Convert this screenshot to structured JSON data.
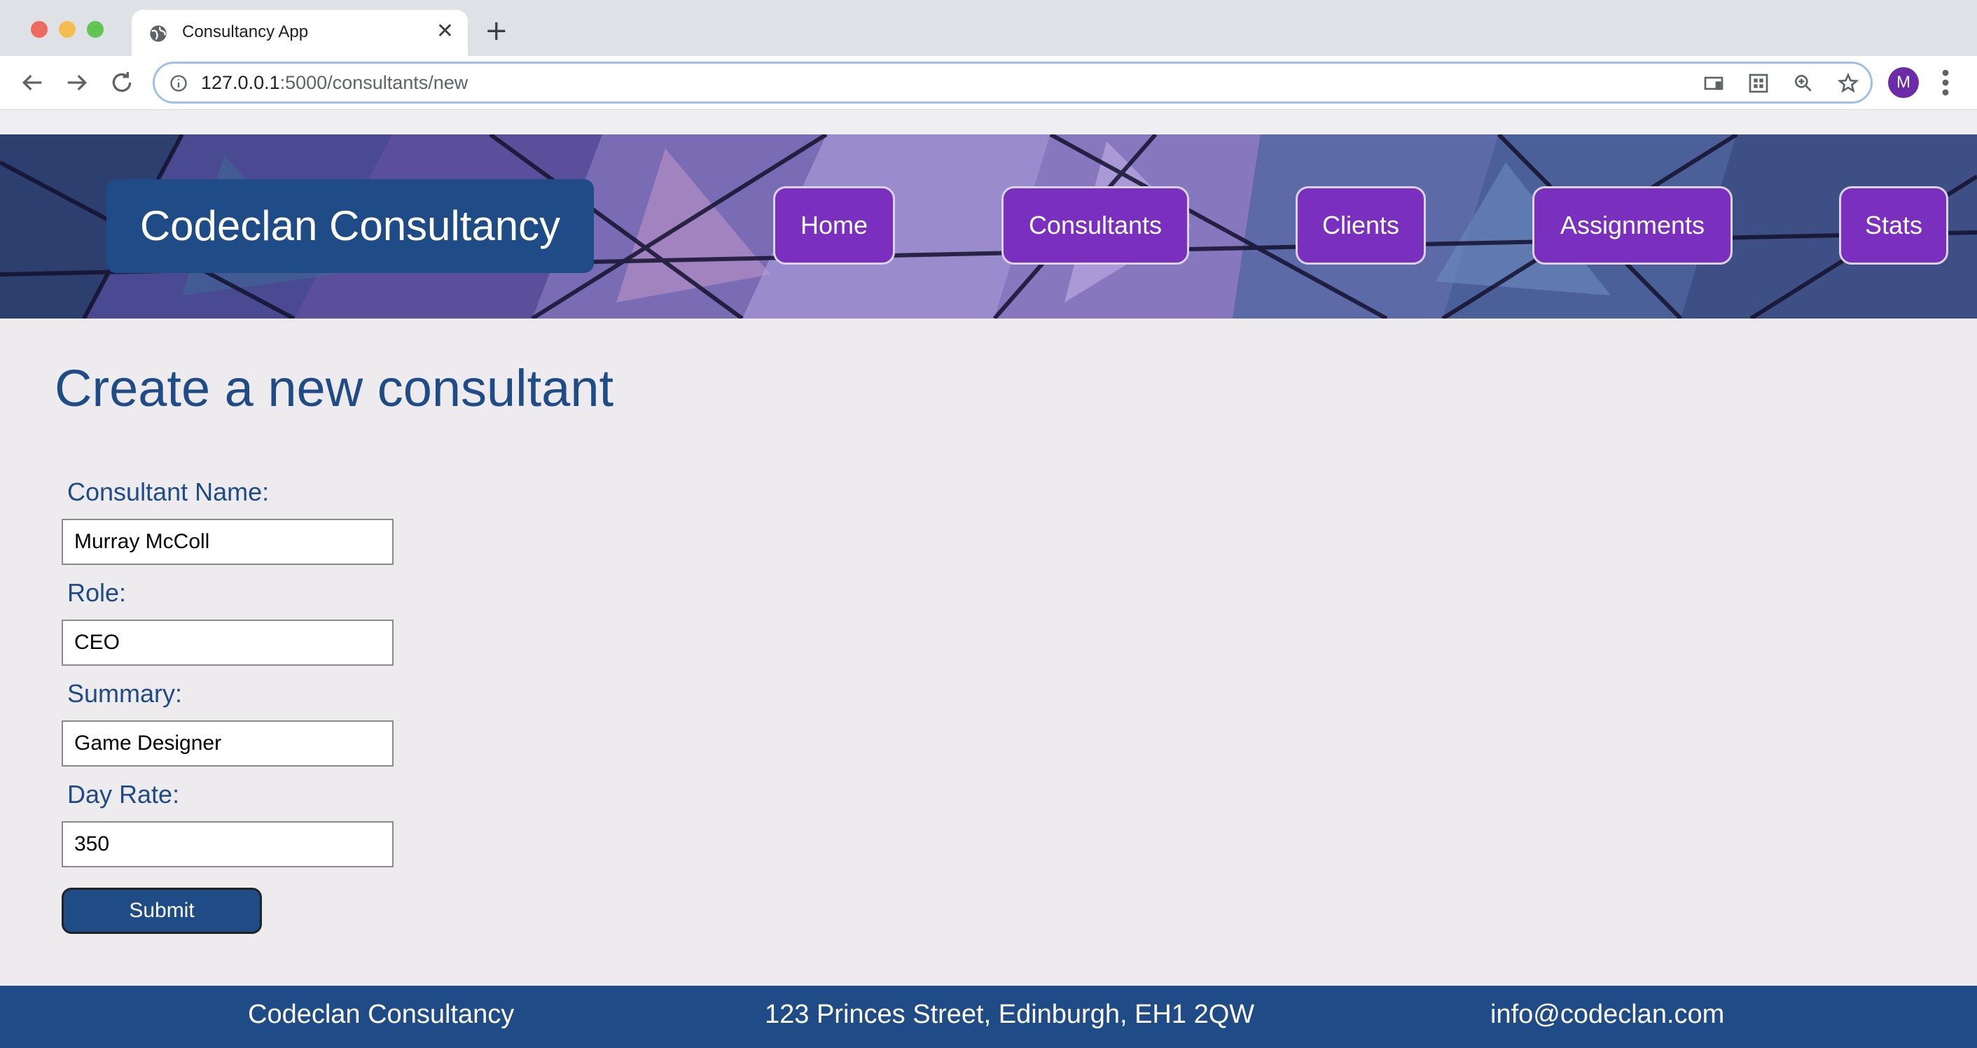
{
  "browser": {
    "tab_title": "Consultancy App",
    "url_host": "127.0.0.1",
    "url_rest": ":5000/consultants/new",
    "profile_initial": "M"
  },
  "header": {
    "brand": "Codeclan Consultancy",
    "nav": [
      {
        "label": "Home"
      },
      {
        "label": "Consultants"
      },
      {
        "label": "Clients"
      },
      {
        "label": "Assignments"
      },
      {
        "label": "Stats"
      }
    ]
  },
  "main": {
    "title": "Create a new consultant",
    "form": {
      "name_label": "Consultant Name:",
      "name_value": "Murray McColl",
      "role_label": "Role:",
      "role_value": "CEO",
      "summary_label": "Summary:",
      "summary_value": "Game Designer",
      "rate_label": "Day Rate:",
      "rate_value": "350",
      "submit_label": "Submit"
    }
  },
  "footer": {
    "company": "Codeclan Consultancy",
    "address": "123 Princes Street, Edinburgh, EH1 2QW",
    "email": "info@codeclan.com"
  },
  "colors": {
    "primary_blue": "#1f4b86",
    "nav_purple": "#7b2fbe",
    "page_bg": "#edebed"
  }
}
